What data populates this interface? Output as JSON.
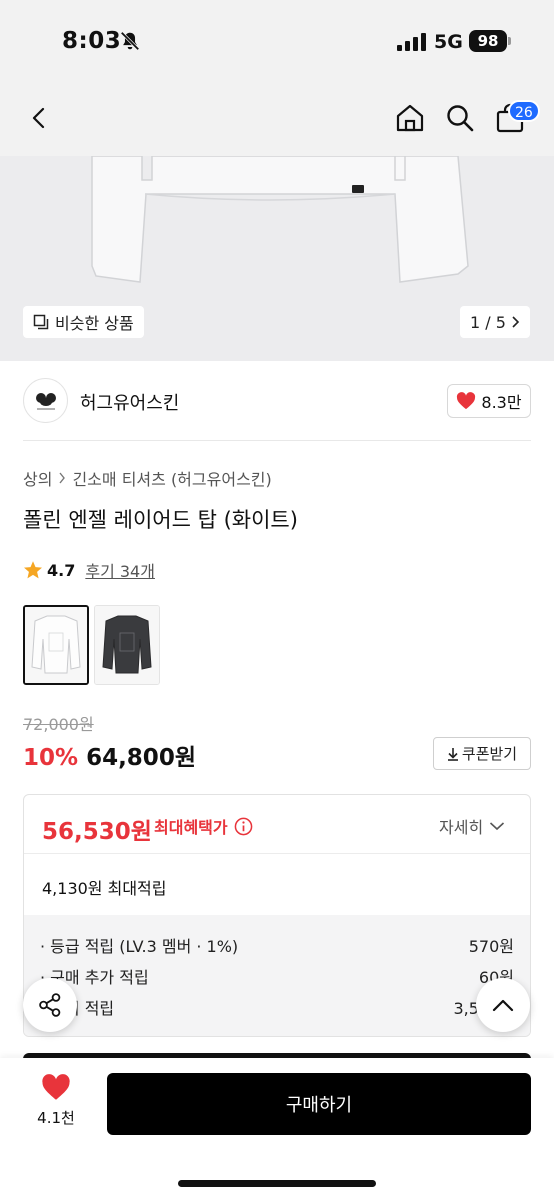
{
  "status_bar": {
    "time": "8:03",
    "network": "5G",
    "battery": "98",
    "icons": [
      "bell-off-icon",
      "signal-icon"
    ]
  },
  "nav": {
    "icons": [
      "back-icon",
      "home-icon",
      "search-icon",
      "cart-icon"
    ],
    "cart_count": "26",
    "accent_color": "#1f6bff"
  },
  "gallery": {
    "similar_label": "비슷한 상품",
    "page_indicator": "1 / 5"
  },
  "brand": {
    "name": "허그유어스킨",
    "likes": "8.3만"
  },
  "product": {
    "breadcrumb": [
      "상의",
      "긴소매 티셔츠 (허그유어스킨)"
    ],
    "title": "폴린 엔젤 레이어드 탑 (화이트)",
    "rating": "4.7",
    "reviews": "후기 34개",
    "colors": [
      "white",
      "charcoal"
    ]
  },
  "price": {
    "original": "72,000원",
    "discount": "10%",
    "sale": "64,800원",
    "coupon_label": "쿠폰받기",
    "discount_color": "#e8343b"
  },
  "benefit": {
    "max_price": "56,530원",
    "max_label": "최대혜택가",
    "detail_label": "자세히",
    "max_points": "4,130원 최대적립",
    "rows": [
      {
        "label": "· 등급 적립 (LV.3 멤버 · 1%)",
        "value": "570원"
      },
      {
        "label": "· 구매 추가 적립",
        "value": "60원"
      },
      {
        "label": "· 후기 적립",
        "value": "3,500원"
      }
    ]
  },
  "bottom": {
    "wish_count": "4.1천",
    "buy_label": "구매하기"
  }
}
